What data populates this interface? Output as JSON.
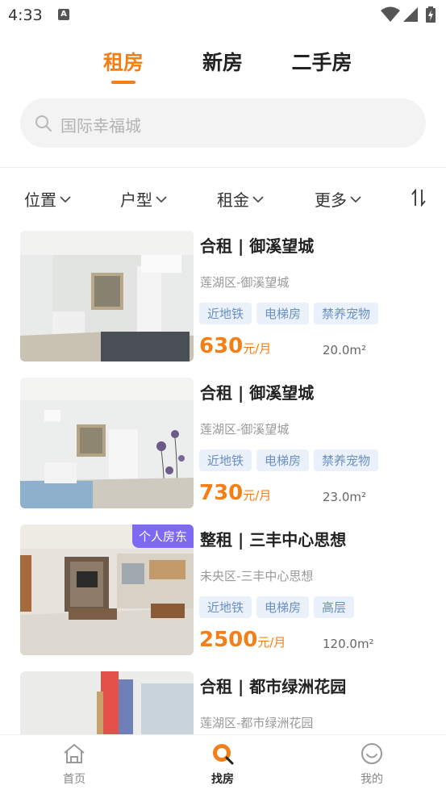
{
  "status_bar": {
    "time": "4:33",
    "notification_icon": "A"
  },
  "top_tabs": [
    {
      "label": "租房",
      "active": true
    },
    {
      "label": "新房",
      "active": false
    },
    {
      "label": "二手房",
      "active": false
    }
  ],
  "search": {
    "placeholder": "国际幸福城"
  },
  "filters": [
    {
      "label": "位置"
    },
    {
      "label": "户型"
    },
    {
      "label": "租金"
    },
    {
      "label": "更多"
    }
  ],
  "listings": [
    {
      "title": "合租 | 御溪望城",
      "area": "莲湖区-御溪望城",
      "tags": [
        "近地铁",
        "电梯房",
        "禁养宠物"
      ],
      "price": "630",
      "unit": "元/月",
      "size": "20.0m²",
      "badge": ""
    },
    {
      "title": "合租 | 御溪望城",
      "area": "莲湖区-御溪望城",
      "tags": [
        "近地铁",
        "电梯房",
        "禁养宠物"
      ],
      "price": "730",
      "unit": "元/月",
      "size": "23.0m²",
      "badge": ""
    },
    {
      "title": "整租 | 三丰中心思想",
      "area": "未央区-三丰中心思想",
      "tags": [
        "近地铁",
        "电梯房",
        "高层"
      ],
      "price": "2500",
      "unit": "元/月",
      "size": "120.0m²",
      "badge": "个人房东"
    },
    {
      "title": "合租 | 都市绿洲花园",
      "area": "莲湖区-都市绿洲花园",
      "tags": [],
      "price": "",
      "unit": "",
      "size": "",
      "badge": ""
    }
  ],
  "bottom_nav": [
    {
      "label": "首页",
      "icon": "home-icon",
      "active": false
    },
    {
      "label": "找房",
      "icon": "find-house-icon",
      "active": true
    },
    {
      "label": "我的",
      "icon": "profile-icon",
      "active": false
    }
  ],
  "colors": {
    "accent": "#f57f17",
    "tag_text": "#6a8fc4",
    "tag_bg": "#eaf1fb",
    "badge": "#7e69f3"
  }
}
